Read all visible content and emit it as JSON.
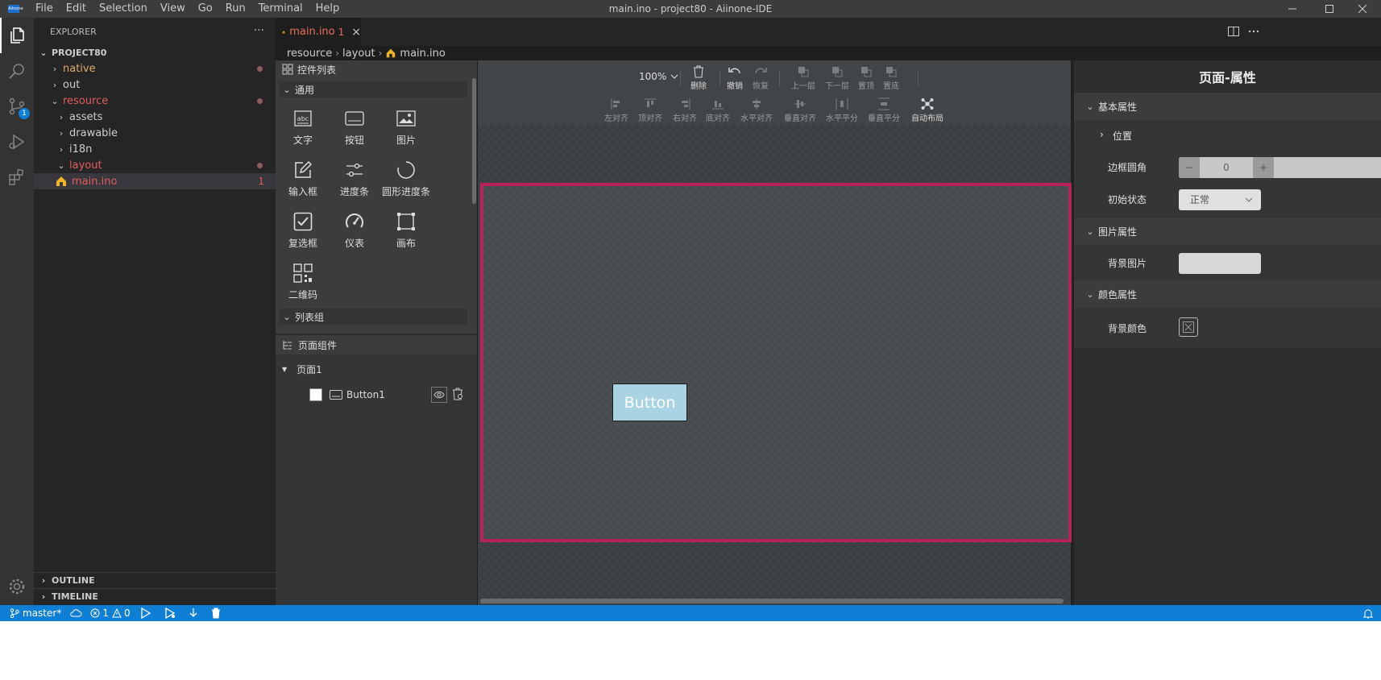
{
  "window": {
    "title": "main.ino - project80 - Aiinone-IDE",
    "menu": [
      "File",
      "Edit",
      "Selection",
      "View",
      "Go",
      "Run",
      "Terminal",
      "Help"
    ]
  },
  "activity": {
    "scm_badge": "1"
  },
  "explorer": {
    "header": "EXPLORER",
    "more": "···",
    "project": "PROJECT80",
    "tree": [
      {
        "label": "native",
        "color": "#e0a96d",
        "chevron": "›",
        "dot": true
      },
      {
        "label": "out",
        "color": "#cccccc",
        "chevron": "›",
        "dot": false
      },
      {
        "label": "resource",
        "color": "#e05d5d",
        "chevron": "⌄",
        "dot": true
      },
      {
        "label": "assets",
        "color": "#cccccc",
        "chevron": "›",
        "dot": false
      },
      {
        "label": "drawable",
        "color": "#cccccc",
        "chevron": "›",
        "dot": false
      },
      {
        "label": "i18n",
        "color": "#cccccc",
        "chevron": "›",
        "dot": false
      },
      {
        "label": "layout",
        "color": "#e05d5d",
        "chevron": "⌄",
        "dot": true
      },
      {
        "label": "main.ino",
        "color": "#e05d5d",
        "chevron": "",
        "dot": false,
        "count": "1"
      }
    ],
    "outline": "OUTLINE",
    "timeline": "TIMELINE"
  },
  "tabs": [
    {
      "label": "main.ino",
      "count": "1",
      "close": "×"
    }
  ],
  "breadcrumb": [
    "resource",
    "layout",
    "main.ino"
  ],
  "widgets": {
    "title": "控件列表",
    "group_common": "通用",
    "items": [
      {
        "label": "文字",
        "icon": "text-abc-icon"
      },
      {
        "label": "按钮",
        "icon": "button-icon"
      },
      {
        "label": "图片",
        "icon": "image-icon"
      },
      {
        "label": "输入框",
        "icon": "edit-icon"
      },
      {
        "label": "进度条",
        "icon": "slider-icon"
      },
      {
        "label": "圆形进度条",
        "icon": "circle-progress-icon"
      },
      {
        "label": "复选框",
        "icon": "checkbox-icon"
      },
      {
        "label": "仪表",
        "icon": "gauge-icon"
      },
      {
        "label": "画布",
        "icon": "canvas-icon"
      },
      {
        "label": "二维码",
        "icon": "qrcode-icon"
      }
    ],
    "group_list": "列表组"
  },
  "components": {
    "title": "页面组件",
    "page": "页面1",
    "item": "Button1"
  },
  "toolbar": {
    "zoom": "100%",
    "row1": [
      {
        "label": "删除",
        "enabled": true
      },
      {
        "label": "撤销",
        "enabled": true
      },
      {
        "label": "恢复",
        "enabled": false
      },
      {
        "label": "上一层",
        "enabled": false
      },
      {
        "label": "下一层",
        "enabled": false
      },
      {
        "label": "置顶",
        "enabled": false
      },
      {
        "label": "置底",
        "enabled": false
      }
    ],
    "row2": [
      {
        "label": "左对齐",
        "enabled": false
      },
      {
        "label": "顶对齐",
        "enabled": false
      },
      {
        "label": "右对齐",
        "enabled": false
      },
      {
        "label": "底对齐",
        "enabled": false
      },
      {
        "label": "水平对齐",
        "enabled": false
      },
      {
        "label": "垂直对齐",
        "enabled": false
      },
      {
        "label": "水平平分",
        "enabled": false
      },
      {
        "label": "垂直平分",
        "enabled": false
      },
      {
        "label": "自动布局",
        "enabled": true
      }
    ]
  },
  "canvas": {
    "button_text": "Button",
    "frame_color": "#b5235a",
    "button_color": "#a9d3e3"
  },
  "props": {
    "title": "页面-属性",
    "basic": "基本属性",
    "position": "位置",
    "radius_label": "边框圆角",
    "radius_value": "0",
    "minus": "−",
    "plus": "+",
    "state_label": "初始状态",
    "state_value": "正常",
    "image_section": "图片属性",
    "bg_image_label": "背景图片",
    "color_section": "颜色属性",
    "bg_color_label": "背景颜色"
  },
  "status": {
    "branch": "master*",
    "errors": "1",
    "warnings": "0"
  }
}
